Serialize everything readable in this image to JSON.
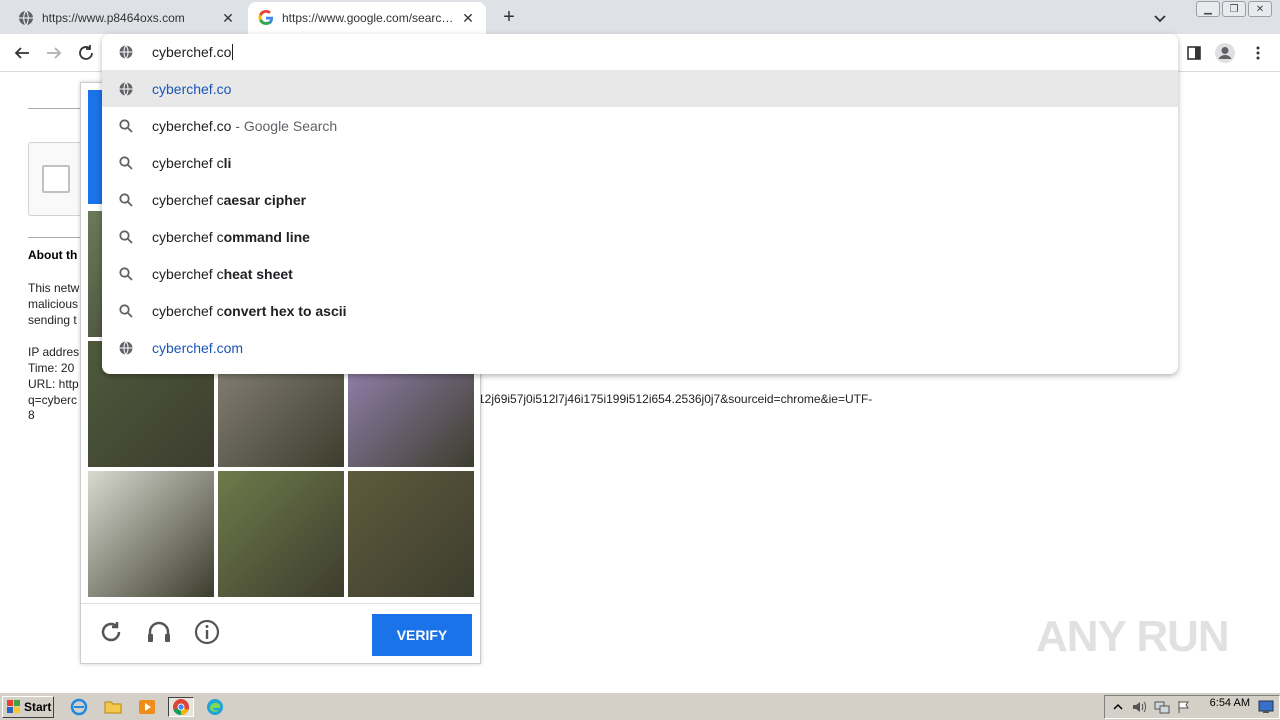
{
  "tabs": [
    {
      "title": "https://www.p8464oxs.com",
      "active": false
    },
    {
      "title": "https://www.google.com/search?q=",
      "active": true
    }
  ],
  "omnibox": {
    "typed": "cyberchef.co",
    "suggestions": [
      {
        "kind": "nav",
        "icon": "globe-icon",
        "typed": "cyberchef.co",
        "rest": "",
        "suffix": ""
      },
      {
        "kind": "search",
        "icon": "search-icon",
        "typed": "cyberchef.co",
        "rest": "",
        "suffix": " - Google Search"
      },
      {
        "kind": "search",
        "icon": "search-icon",
        "typed": "cyberchef c",
        "rest": "li",
        "suffix": ""
      },
      {
        "kind": "search",
        "icon": "search-icon",
        "typed": "cyberchef c",
        "rest": "aesar cipher",
        "suffix": ""
      },
      {
        "kind": "search",
        "icon": "search-icon",
        "typed": "cyberchef c",
        "rest": "ommand line",
        "suffix": ""
      },
      {
        "kind": "search",
        "icon": "search-icon",
        "typed": "cyberchef c",
        "rest": "heat sheet",
        "suffix": ""
      },
      {
        "kind": "search",
        "icon": "search-icon",
        "typed": "cyberchef c",
        "rest": "onvert hex to ascii",
        "suffix": ""
      },
      {
        "kind": "nav",
        "icon": "globe-icon",
        "typed": "cyberchef.co",
        "rest": "m",
        "suffix": ""
      }
    ]
  },
  "page": {
    "about": "About th",
    "para_lines": [
      "This netw",
      "malicious",
      "sending t"
    ],
    "info_lines": [
      "IP addres",
      "Time: 20",
      "URL: http",
      "q=cyberc"
    ],
    "url_tail": "12j69i57j0i512l7j46i175i199i512i654.2536j0j7&sourceid=chrome&ie=UTF-",
    "url_end": "8"
  },
  "captcha": {
    "verify_label": "VERIFY",
    "cells": [
      {
        "name": "captcha-tile-1",
        "color": "#6b7a5a"
      },
      {
        "name": "captcha-tile-2",
        "color": "#7a8a6a"
      },
      {
        "name": "captcha-tile-3",
        "color": "#8c7e6e"
      },
      {
        "name": "captcha-tile-4",
        "color": "#4e5a3c"
      },
      {
        "name": "captcha-tile-5",
        "color": "#8a857a"
      },
      {
        "name": "captcha-tile-6",
        "color": "#9a86b8"
      },
      {
        "name": "captcha-tile-7",
        "color": "#d8dad0"
      },
      {
        "name": "captcha-tile-8",
        "color": "#6e7a4a"
      },
      {
        "name": "captcha-tile-9",
        "color": "#5e5a3c"
      }
    ]
  },
  "watermark": "ANY RUN",
  "taskbar": {
    "start_label": "Start",
    "clock": "6:54 AM"
  },
  "colors": {
    "accent": "#1a73e8",
    "link": "#1a55b8"
  }
}
